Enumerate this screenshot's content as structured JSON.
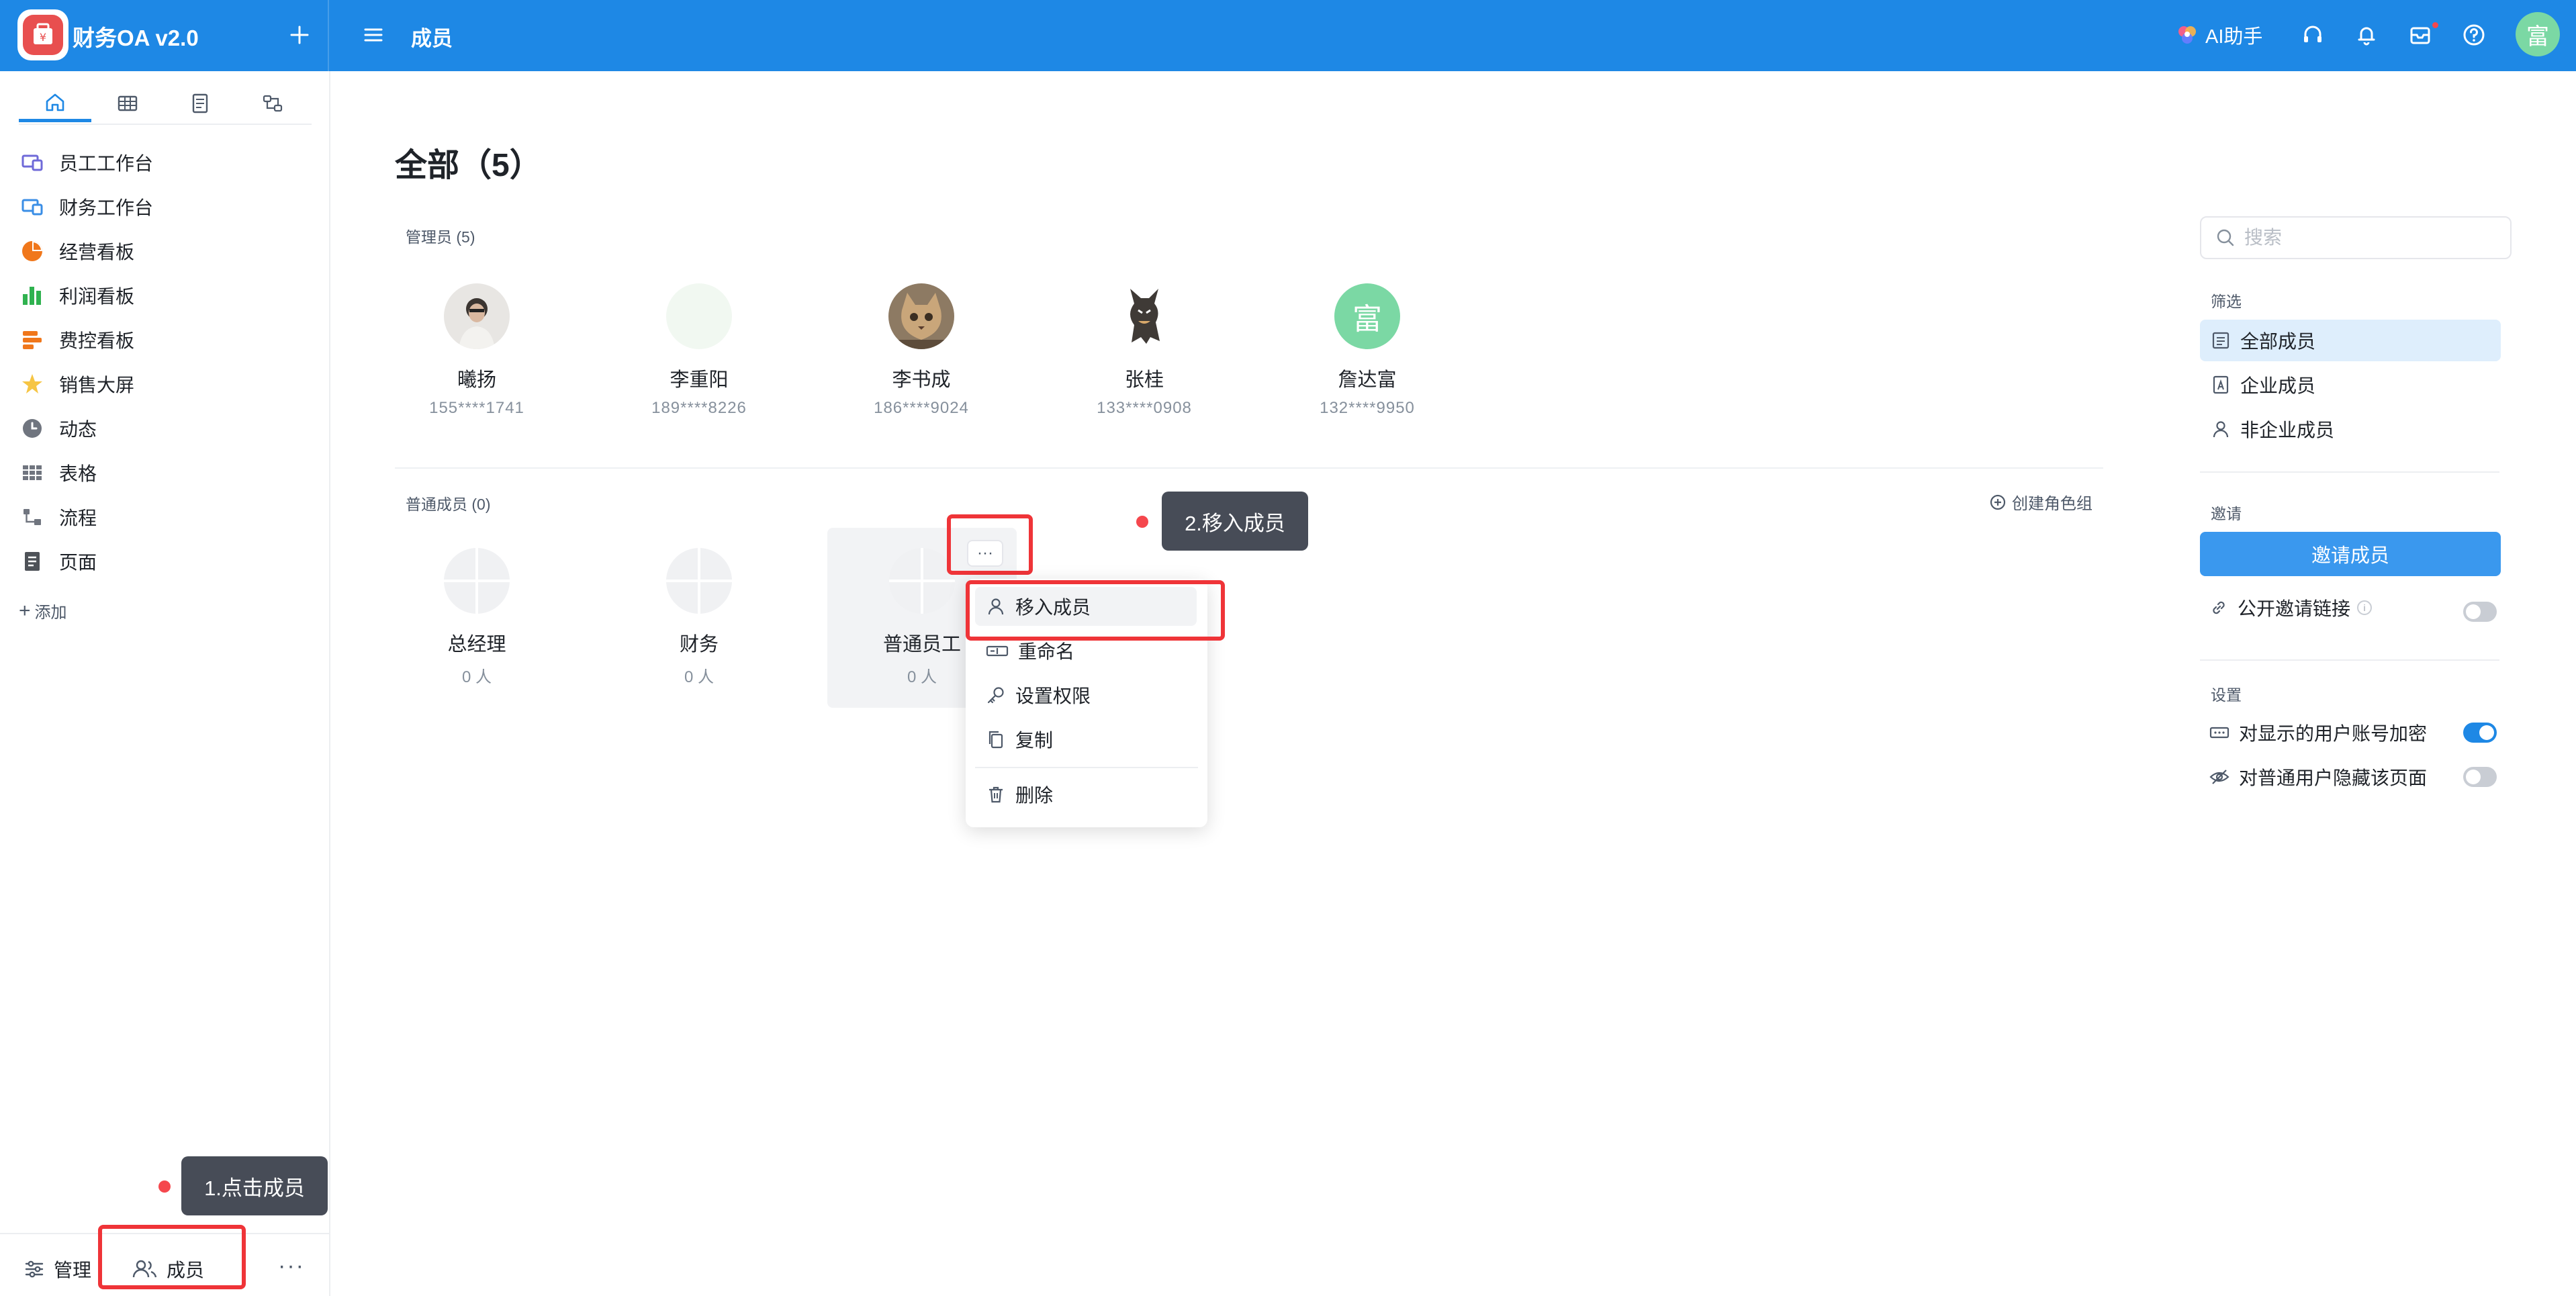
{
  "header": {
    "app_title": "财务OA v2.0",
    "page_title": "成员",
    "ai_label": "AI助手",
    "user_avatar_text": "富",
    "brand_color": "#1e88e5"
  },
  "sidebar": {
    "tabs": [
      {
        "icon": "home-icon",
        "active": true
      },
      {
        "icon": "table-icon",
        "active": false
      },
      {
        "icon": "document-icon",
        "active": false
      },
      {
        "icon": "flow-icon",
        "active": false
      }
    ],
    "items": [
      {
        "label": "员工工作台",
        "icon": "workbench-icon"
      },
      {
        "label": "财务工作台",
        "icon": "workbench-icon"
      },
      {
        "label": "经营看板",
        "icon": "pie-chart-icon"
      },
      {
        "label": "利润看板",
        "icon": "bar-chart-icon"
      },
      {
        "label": "费控看板",
        "icon": "bar-h-chart-icon"
      },
      {
        "label": "销售大屏",
        "icon": "star-icon"
      },
      {
        "label": "动态",
        "icon": "clock-icon"
      },
      {
        "label": "表格",
        "icon": "grid-icon"
      },
      {
        "label": "流程",
        "icon": "flow-icon"
      },
      {
        "label": "页面",
        "icon": "page-icon"
      }
    ],
    "add_label": "添加",
    "bottom": {
      "manage_label": "管理",
      "members_label": "成员"
    }
  },
  "annotations": {
    "step1": "1.点击成员",
    "step2": "2.移入成员"
  },
  "main": {
    "title": "全部（5）",
    "admins_label": "管理员 (5)",
    "admins": [
      {
        "name": "曦扬",
        "phone": "155****1741"
      },
      {
        "name": "李重阳",
        "phone": "189****8226"
      },
      {
        "name": "李书成",
        "phone": "186****9024"
      },
      {
        "name": "张桂",
        "phone": "133****0908"
      },
      {
        "name": "詹达富",
        "phone": "132****9950",
        "avatar_text": "富"
      }
    ],
    "members_label": "普通成员 (0)",
    "create_role_label": "创建角色组",
    "roles": [
      {
        "name": "总经理",
        "count": "0 人"
      },
      {
        "name": "财务",
        "count": "0 人"
      },
      {
        "name": "普通员工",
        "count": "0 人"
      }
    ],
    "more_label": "···",
    "context_menu": [
      {
        "label": "移入成员",
        "icon": "user-icon"
      },
      {
        "label": "重命名",
        "icon": "rename-icon"
      },
      {
        "label": "设置权限",
        "icon": "key-icon"
      },
      {
        "label": "复制",
        "icon": "copy-icon"
      },
      {
        "label": "删除",
        "icon": "trash-icon"
      }
    ]
  },
  "right_panel": {
    "search_placeholder": "搜索",
    "filter_label": "筛选",
    "filters": [
      {
        "label": "全部成员",
        "active": true
      },
      {
        "label": "企业成员",
        "active": false
      },
      {
        "label": "非企业成员",
        "active": false
      }
    ],
    "invite_label": "邀请",
    "invite_button": "邀请成员",
    "public_link": "公开邀请链接",
    "public_link_enabled": false,
    "settings_label": "设置",
    "settings": [
      {
        "label": "对显示的用户账号加密",
        "enabled": true
      },
      {
        "label": "对普通用户隐藏该页面",
        "enabled": false
      }
    ]
  }
}
